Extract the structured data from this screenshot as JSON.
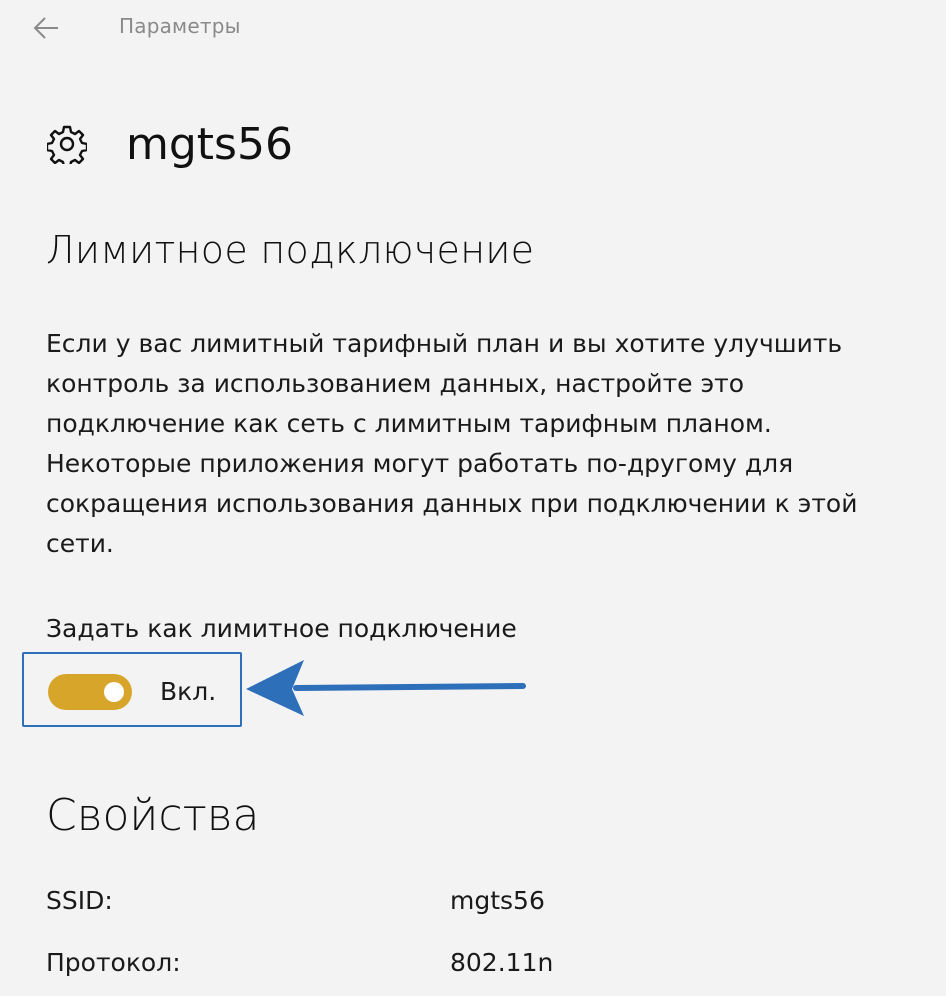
{
  "window": {
    "app_title": "Параметры",
    "back_icon": "back-arrow-icon"
  },
  "header": {
    "icon": "gear-icon",
    "title": "mgts56"
  },
  "metered": {
    "section_title": "Лимитное подключение",
    "description": "Если у вас лимитный тарифный план и вы хотите улучшить контроль за использованием данных, настройте это подключение как сеть с лимитным тарифным планом. Некоторые приложения могут работать по-другому для сокращения использования данных при подключении к этой сети.",
    "toggle_label": "Задать как лимитное подключение",
    "toggle_state": "Вкл.",
    "toggle_on": true,
    "toggle_color": "#d6a52a",
    "highlight_color": "#2e6fba"
  },
  "properties": {
    "section_title": "Свойства",
    "rows": [
      {
        "key": "SSID:",
        "value": "mgts56"
      },
      {
        "key": "Протокол:",
        "value": "802.11n"
      }
    ]
  }
}
